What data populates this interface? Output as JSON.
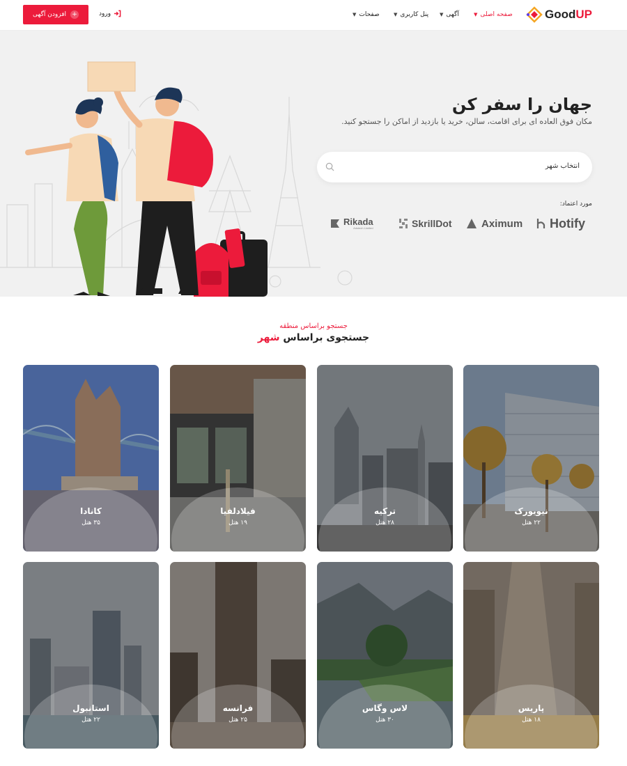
{
  "header": {
    "logo_good": "Good",
    "logo_up": "UP",
    "nav": [
      {
        "label": "صفحه اصلی",
        "active": true
      },
      {
        "label": "آگهی",
        "active": false
      },
      {
        "label": "پنل کاربری",
        "active": false
      },
      {
        "label": "صفحات",
        "active": false
      }
    ],
    "login_label": "ورود",
    "add_listing_label": "افزودن آگهی",
    "add_listing_icon": "+"
  },
  "hero": {
    "title": "جهان را سفر کن",
    "subtitle": "مکان فوق العاده ای برای اقامت، سالن، خرید یا بازدید از اماکن را جستجو کنید.",
    "search_placeholder": "انتخاب شهر",
    "trusted_label": "مورد اعتماد:",
    "brands": [
      "Hotify",
      "Aximum",
      "SkrillDot",
      "Rikada"
    ],
    "brand_rikada_tagline": "Adstech Limited"
  },
  "section": {
    "subtitle": "جستجو براساس منطقه",
    "title_prefix": "جستجوی براساس ",
    "title_accent": "شهر"
  },
  "cities": [
    {
      "name": "نیویورک",
      "count": "۲۲ هتل"
    },
    {
      "name": "ترکیه",
      "count": "۲۸ هتل"
    },
    {
      "name": "فیلادلفیا",
      "count": "۱۹ هتل"
    },
    {
      "name": "کانادا",
      "count": "۳۵ هتل"
    },
    {
      "name": "پاریس",
      "count": "۱۸ هتل"
    },
    {
      "name": "لاس وگاس",
      "count": "۳۰ هتل"
    },
    {
      "name": "فرانسه",
      "count": "۲۵ هتل"
    },
    {
      "name": "استانبول",
      "count": "۲۲ هتل"
    }
  ],
  "colors": {
    "accent": "#ec1b3b",
    "hero_bg": "#f1f1f1",
    "text": "#222222"
  }
}
